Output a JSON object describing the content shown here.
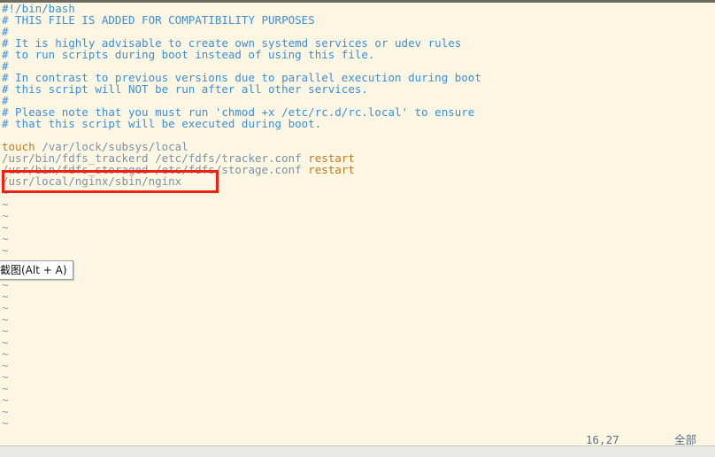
{
  "app": {
    "name": "vim",
    "file_type": "shell-script"
  },
  "editor": {
    "lines": [
      {
        "n": 1,
        "text": "#!/bin/bash",
        "kind": "comment"
      },
      {
        "n": 2,
        "text": "# THIS FILE IS ADDED FOR COMPATIBILITY PURPOSES",
        "kind": "comment"
      },
      {
        "n": 3,
        "text": "#",
        "kind": "comment"
      },
      {
        "n": 4,
        "text": "# It is highly advisable to create own systemd services or udev rules",
        "kind": "comment"
      },
      {
        "n": 5,
        "text": "# to run scripts during boot instead of using this file.",
        "kind": "comment"
      },
      {
        "n": 6,
        "text": "#",
        "kind": "comment"
      },
      {
        "n": 7,
        "text": "# In contrast to previous versions due to parallel execution during boot",
        "kind": "comment"
      },
      {
        "n": 8,
        "text": "# this script will NOT be run after all other services.",
        "kind": "comment"
      },
      {
        "n": 9,
        "text": "#",
        "kind": "comment"
      },
      {
        "n": 10,
        "text": "# Please note that you must run 'chmod +x /etc/rc.d/rc.local' to ensure",
        "kind": "comment"
      },
      {
        "n": 11,
        "text": "# that this script will be executed during boot.",
        "kind": "comment"
      },
      {
        "n": 12,
        "text": "",
        "kind": "blank"
      },
      {
        "n": 13,
        "text": "touch /var/lock/subsys/local",
        "kind": "cmd",
        "keyword": "touch",
        "rest": " /var/lock/subsys/local"
      },
      {
        "n": 14,
        "text": "/usr/bin/fdfs_trackerd /etc/fdfs/tracker.conf restart",
        "kind": "cmd-trailing",
        "path": "/usr/bin/fdfs_trackerd /etc/fdfs/tracker.conf ",
        "keyword": "restart"
      },
      {
        "n": 15,
        "text": "/usr/bin/fdfs_storaged /etc/fdfs/storage.conf restart",
        "kind": "cmd-trailing",
        "path": "/usr/bin/fdfs_storaged /etc/fdfs/storage.conf ",
        "keyword": "restart"
      },
      {
        "n": 16,
        "text": "/usr/local/nginx/sbin/nginx",
        "kind": "path"
      }
    ],
    "empty_marker": "~",
    "empty_marker_count": 22
  },
  "annotation": {
    "highlight_line": "/usr/local/nginx/sbin/nginx",
    "color": "#f41f10"
  },
  "tooltip": {
    "label": "截图(Alt + A)"
  },
  "statusline": {
    "position": "16,27",
    "scroll": "全部"
  },
  "colors": {
    "background": "#fdf6e3",
    "comment": "#3b8fd4",
    "path": "#7a93a8",
    "keyword": "#c07a1d",
    "tilde": "#7f99ad",
    "status_text": "#5b7287",
    "annotation": "#f41f10"
  }
}
